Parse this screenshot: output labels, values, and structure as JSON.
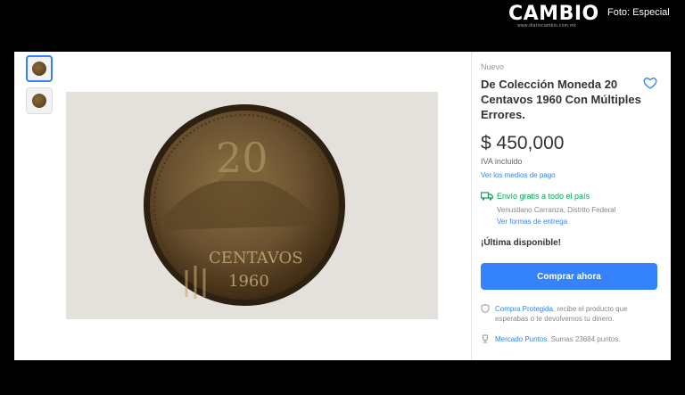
{
  "header": {
    "brand": "CAMBIO",
    "brand_sub": "www.diariocambio.com.mx",
    "photo_credit": "Foto: Especial"
  },
  "listing": {
    "condition": "Nuevo",
    "title": "De Colección Moneda 20 Centavos 1960 Con Múltiples Errores.",
    "price": "$ 450,000",
    "tax_note": "IVA incluido",
    "payment_link": "Ver los medios de pago",
    "shipping": "Envío gratis a todo el país",
    "location": "Venustiano Carranza, Distrito Federal",
    "shipping_link": "Ver formas de entrega",
    "stock": "¡Última disponible!",
    "buy_button": "Comprar ahora",
    "protected_label": "Compra Protegida",
    "protected_text": ", recibe el producto que esperabas o te devolvemos tu dinero.",
    "points_label": "Mercado Puntos",
    "points_text": ". Sumas 23684 puntos."
  },
  "colors": {
    "accent": "#3483fa",
    "shipping_green": "#00a650"
  },
  "icons": [
    "heart-icon",
    "truck-icon",
    "shield-icon",
    "trophy-icon"
  ]
}
